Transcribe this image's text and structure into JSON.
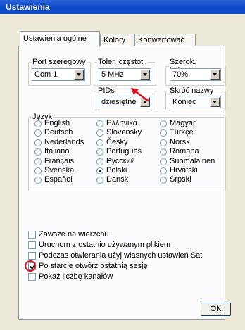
{
  "window": {
    "title": "Ustawienia"
  },
  "tabs": [
    {
      "label": "Ustawienia ogólne"
    },
    {
      "label": "Kolory"
    },
    {
      "label": "Konwertować"
    }
  ],
  "port": {
    "legend": "Port szeregowy",
    "value": "Com 1"
  },
  "tolerance": {
    "legend": "Toler. częstotl.",
    "value": "5 MHz"
  },
  "column_width": {
    "legend": "Szerok. kolumny",
    "value": "70%"
  },
  "pids": {
    "legend": "PIDs",
    "value": "dziesiętne"
  },
  "shortcut": {
    "legend": "Skróć nazwy",
    "value": "Koniec"
  },
  "language": {
    "legend": "Język",
    "selected": "Polski",
    "options": [
      "English",
      "Deutsch",
      "Nederlands",
      "Italiano",
      "Français",
      "Svenska",
      "Español",
      "Ελληνικά",
      "Slovensky",
      "Česky",
      "Português",
      "Русский",
      "Polski",
      "Dansk",
      "Magyar",
      "Türkçe",
      "Norsk",
      "Romana",
      "Suomalainen",
      "Hrvatski",
      "Srpski"
    ]
  },
  "checkboxes": [
    {
      "label": "Zawsze na wierzchu",
      "checked": false
    },
    {
      "label": "Uruchom z ostatnio używanym plikiem",
      "checked": false
    },
    {
      "label": "Podczas otwierania użyj własnych ustawień Sat",
      "checked": false
    },
    {
      "label": "Po starcie otwórz ostatnią sesję",
      "checked": true
    },
    {
      "label": "Pokaż liczbę kanałów",
      "checked": false
    }
  ],
  "ok_button": {
    "label": "OK"
  },
  "colors": {
    "title_bar": "#0a46c8",
    "annotation_red": "#e0101b"
  }
}
